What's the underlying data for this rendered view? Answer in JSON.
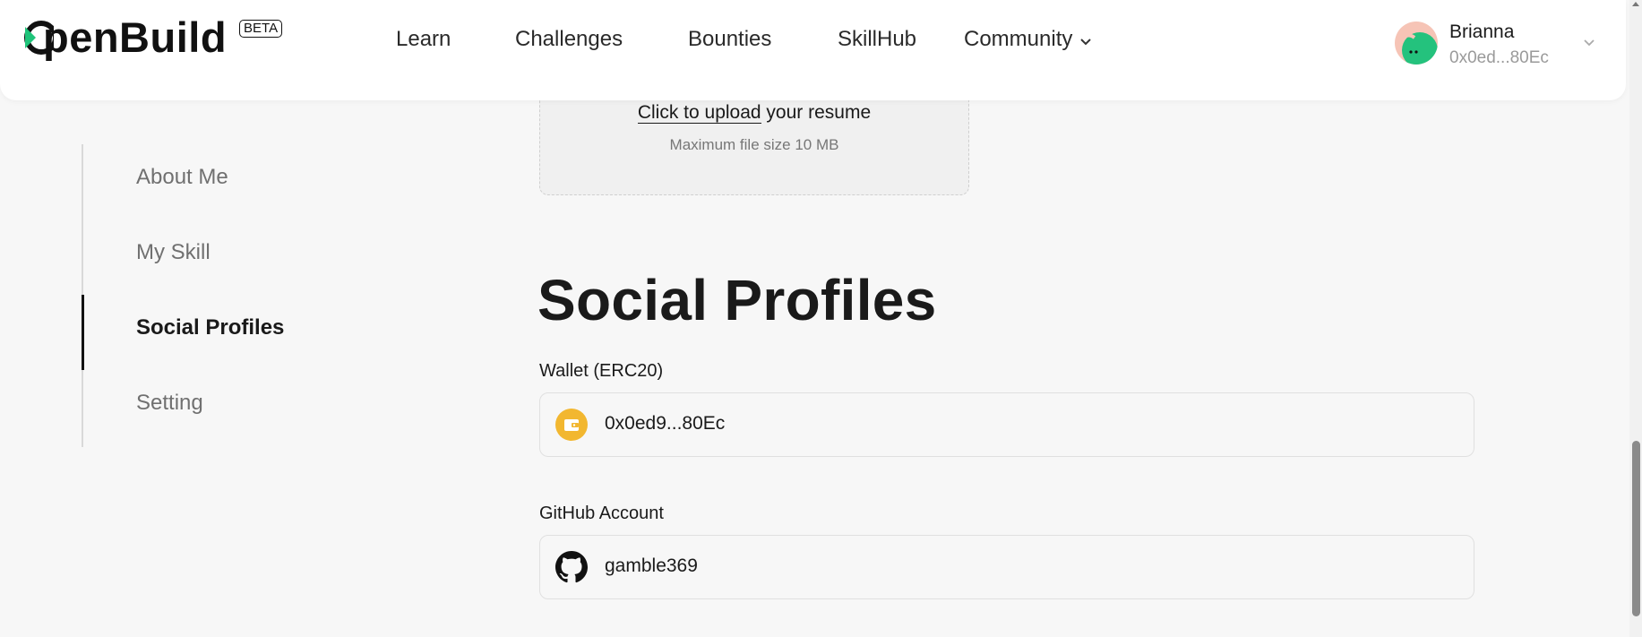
{
  "header": {
    "logo_text": "penBuild",
    "beta_label": "BETA",
    "nav": [
      {
        "label": "Learn"
      },
      {
        "label": "Challenges"
      },
      {
        "label": "Bounties"
      },
      {
        "label": "SkillHub"
      },
      {
        "label": "Community",
        "has_dropdown": true
      }
    ],
    "user": {
      "name": "Brianna",
      "address": "0x0ed...80Ec"
    }
  },
  "sidebar": {
    "items": [
      {
        "label": "About Me"
      },
      {
        "label": "My Skill"
      },
      {
        "label": "Social Profiles",
        "active": true
      },
      {
        "label": "Setting"
      }
    ]
  },
  "upload": {
    "link_text": "Click to upload",
    "rest_text": " your resume",
    "size_note": "Maximum file size 10 MB"
  },
  "social": {
    "title": "Social Profiles",
    "wallet_label": "Wallet (ERC20)",
    "wallet_value": "0x0ed9...80Ec",
    "github_label": "GitHub Account",
    "github_value": "gamble369"
  },
  "colors": {
    "brand_green": "#1fc47a",
    "wallet_yellow": "#f2b730",
    "background": "#f7f7f7"
  }
}
